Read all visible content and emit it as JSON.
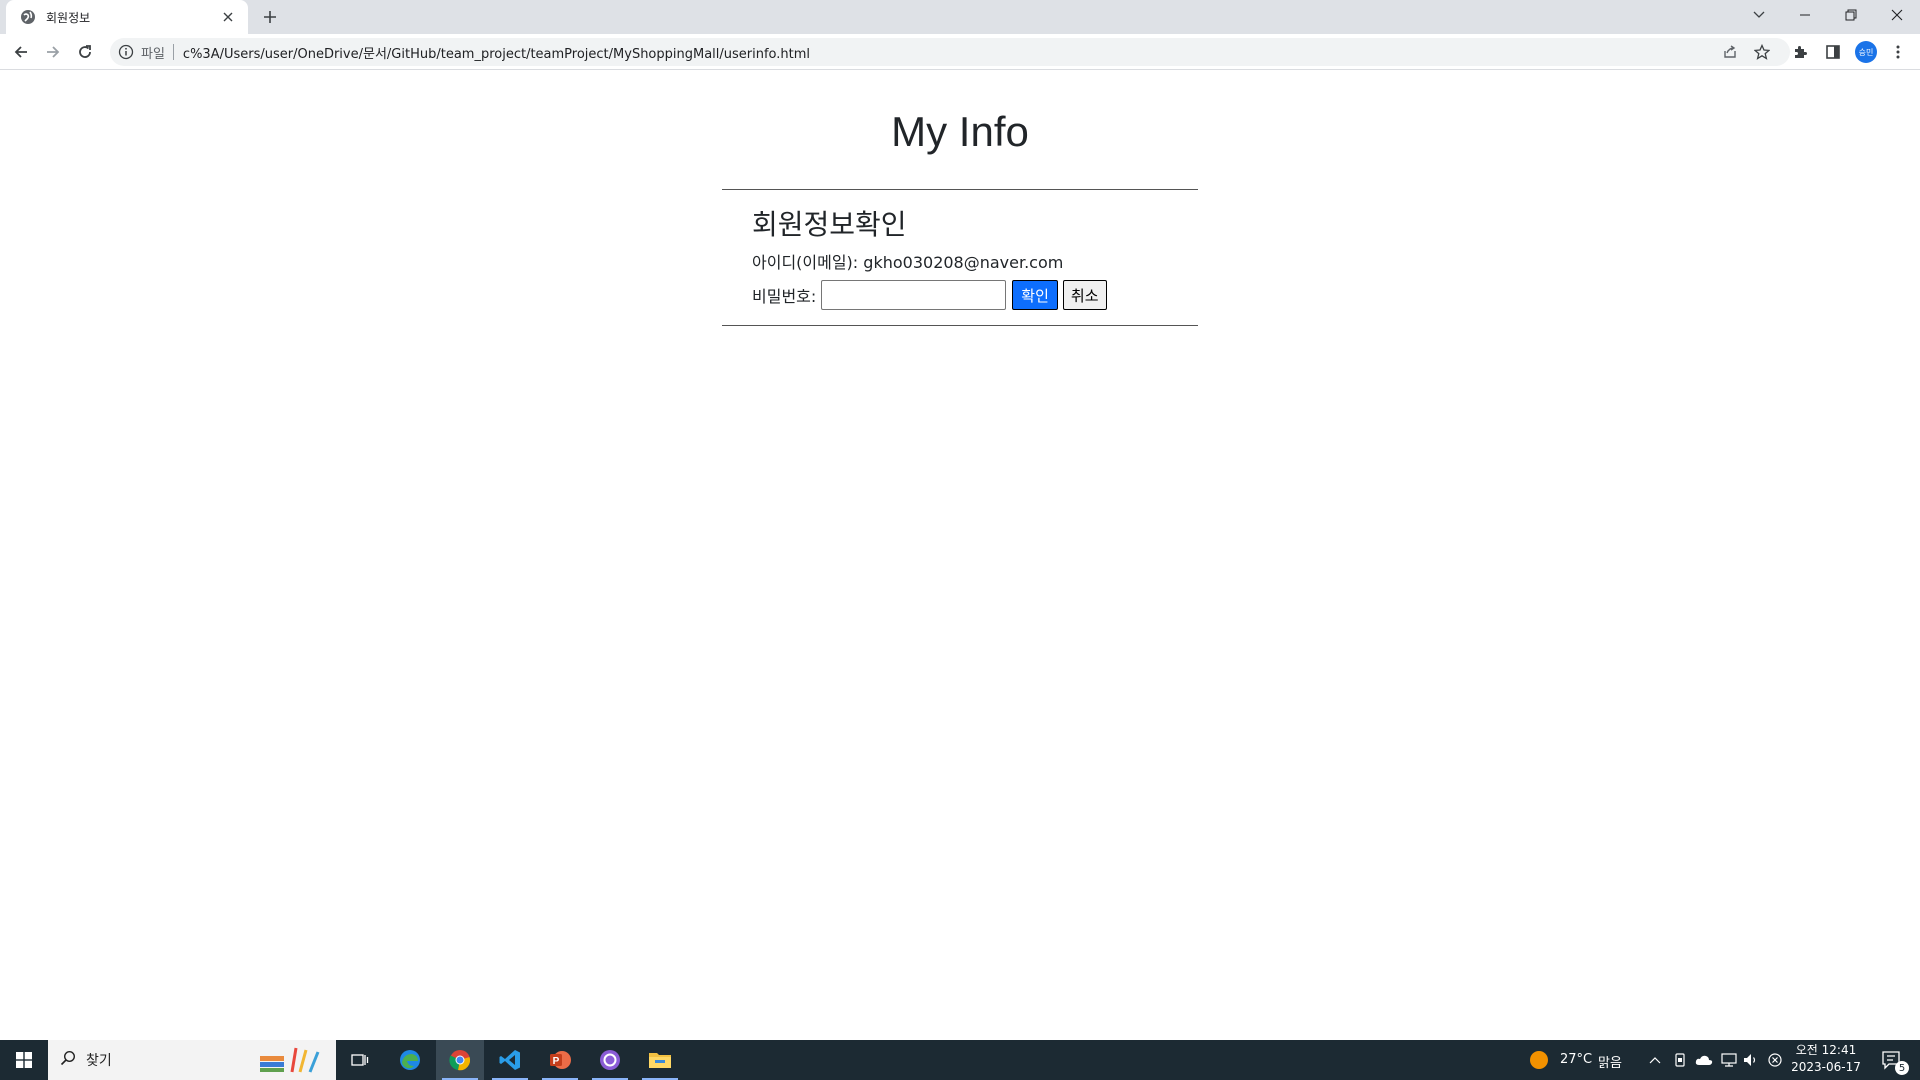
{
  "browser": {
    "tab": {
      "title": "회원정보"
    },
    "address": {
      "scheme_label": "파일",
      "url": "c%3A/Users/user/OneDrive/문서/GitHub/team_project/teamProject/MyShoppingMall/userinfo.html"
    },
    "profile_initials": "승민"
  },
  "page": {
    "title": "My Info",
    "section_title": "회원정보확인",
    "id_label": "아이디(이메일):",
    "id_value": "gkho030208@naver.com",
    "password_label": "비밀번호:",
    "password_value": "",
    "confirm_label": "확인",
    "cancel_label": "취소"
  },
  "taskbar": {
    "search_placeholder": "찾기",
    "weather": {
      "temp": "27°C",
      "condition": "맑음"
    },
    "clock": {
      "time": "오전 12:41",
      "date": "2023-06-17"
    },
    "notification_count": "5",
    "apps": [
      "edge-icon",
      "chrome-icon",
      "vscode-icon",
      "powerpoint-icon",
      "github-desktop-icon",
      "file-explorer-icon"
    ]
  },
  "colors": {
    "accent": "#0d6efd",
    "taskbar": "#1c2a33",
    "tabstrip": "#dee1e6"
  }
}
